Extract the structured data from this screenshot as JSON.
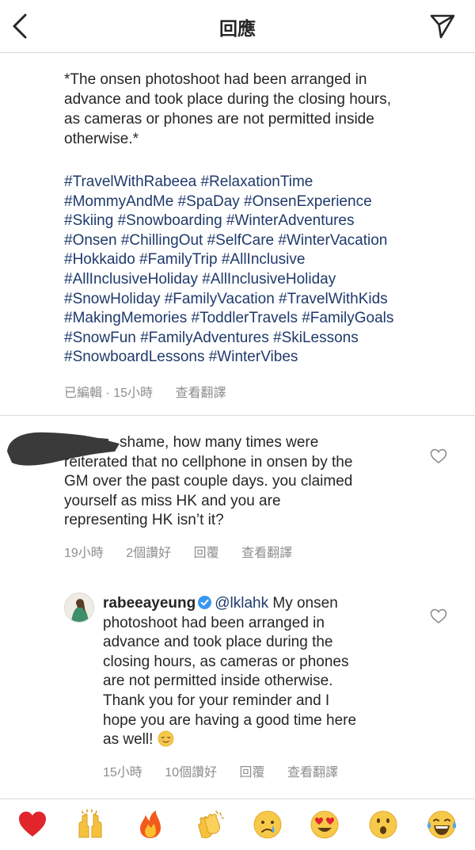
{
  "header": {
    "title": "回應",
    "back_icon": "chevron-left-icon",
    "send_icon": "paper-plane-icon"
  },
  "caption": {
    "lines": [
      "*The onsen photoshoot had been arranged in",
      "advance and took place during the closing hours,",
      "as cameras or phones are not permitted inside",
      "otherwise.*"
    ],
    "hashtag_lines": [
      "#TravelWithRabeea #RelaxationTime",
      "#MommyAndMe #SpaDay #OnsenExperience",
      "#Skiing #Snowboarding #WinterAdventures",
      "#Onsen #ChillingOut #SelfCare #WinterVacation",
      "#Hokkaido #FamilyTrip #AllInclusive",
      "#AllInclusiveHoliday #AllInclusiveHoliday",
      "#SnowHoliday #FamilyVacation #TravelWithKids",
      "#MakingMemories #ToddlerTravels #FamilyGoals",
      "#SnowFun #FamilyAdventures #SkiLessons",
      "#SnowboardLessons #WinterVibes"
    ],
    "edited": "已編輯",
    "dot": "·",
    "time": "15小時",
    "translate": "查看翻譯"
  },
  "comment": {
    "lines": [
      "shame, how many times were",
      "reiterated that no cellphone in onsen by the",
      "GM over the past couple days. you claimed",
      "yourself as miss HK and you are",
      "representing HK isn’t it?"
    ],
    "time": "19小時",
    "likes": "2個讚好",
    "reply": "回覆",
    "translate": "查看翻譯"
  },
  "reply": {
    "username": "rabeeayeung",
    "mention": "@lklahk",
    "first_line_rest": " My onsen",
    "lines": [
      "photoshoot had been arranged in",
      "advance and took place during the",
      "closing hours, as cameras or phones",
      "are not permitted inside otherwise.",
      "Thank you for your reminder and I",
      "hope you are having a good time here"
    ],
    "last_line": "as well! ",
    "time": "15小時",
    "likes": "10個讚好",
    "reply": "回覆",
    "translate": "查看翻譯"
  },
  "reactions": [
    "red-heart",
    "raised-hands",
    "fire",
    "clapping-hands",
    "crying-face",
    "heart-eyes",
    "surprised-face",
    "laughing-tears"
  ],
  "colors": {
    "hashtag": "#1f3a6b",
    "meta": "#8e8e8e",
    "divider": "#dbdbdb",
    "verified": "#3897f0"
  }
}
